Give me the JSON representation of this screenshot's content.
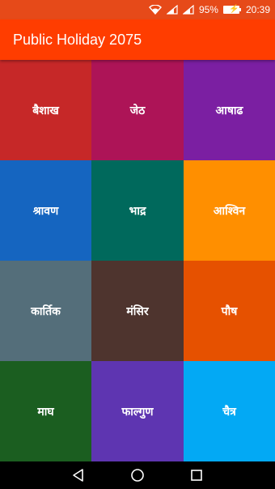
{
  "status_bar": {
    "battery": "95%",
    "time": "20:39"
  },
  "app_bar": {
    "title": "Public Holiday 2075"
  },
  "months": [
    {
      "label": "बैशाख",
      "color": "#C62828"
    },
    {
      "label": "जेठ",
      "color": "#AD1457"
    },
    {
      "label": "आषाढ",
      "color": "#7B1FA2"
    },
    {
      "label": "श्रावण",
      "color": "#1565C0"
    },
    {
      "label": "भाद्र",
      "color": "#00695C"
    },
    {
      "label": "आश्विन",
      "color": "#FF8F00"
    },
    {
      "label": "कार्तिक",
      "color": "#546E7A"
    },
    {
      "label": "मंसिर",
      "color": "#4E342E"
    },
    {
      "label": "पौष",
      "color": "#E65100"
    },
    {
      "label": "माघ",
      "color": "#1B5E20"
    },
    {
      "label": "फाल्गुण",
      "color": "#5E35B1"
    },
    {
      "label": "चैत्र",
      "color": "#03A9F4"
    }
  ],
  "icons": {
    "wifi": "wifi-icon",
    "signal_1": "signal-icon",
    "signal_2": "signal-icon",
    "battery": "battery-charging-icon",
    "back": "back-icon",
    "home": "home-icon",
    "recents": "recents-icon"
  }
}
